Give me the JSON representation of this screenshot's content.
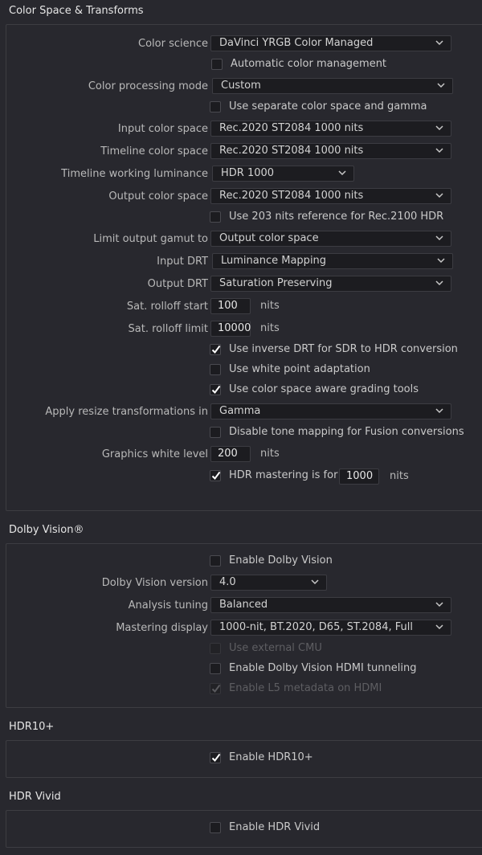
{
  "sections": {
    "color": {
      "title": "Color Space & Transforms",
      "color_science": {
        "label": "Color science",
        "value": "DaVinci YRGB Color Managed"
      },
      "auto_color": {
        "label": "Automatic color management",
        "checked": false
      },
      "processing_mode": {
        "label": "Color processing mode",
        "value": "Custom"
      },
      "separate_gamma": {
        "label": "Use separate color space and gamma",
        "checked": false
      },
      "input_cs": {
        "label": "Input color space",
        "value": "Rec.2020 ST2084 1000 nits"
      },
      "timeline_cs": {
        "label": "Timeline color space",
        "value": "Rec.2020 ST2084 1000 nits"
      },
      "timeline_lum": {
        "label": "Timeline working luminance",
        "value": "HDR 1000"
      },
      "output_cs": {
        "label": "Output color space",
        "value": "Rec.2020 ST2084 1000 nits"
      },
      "use_203": {
        "label": "Use 203 nits reference for Rec.2100 HDR",
        "checked": false
      },
      "limit_gamut": {
        "label": "Limit output gamut to",
        "value": "Output color space"
      },
      "input_drt": {
        "label": "Input DRT",
        "value": "Luminance Mapping"
      },
      "output_drt": {
        "label": "Output DRT",
        "value": "Saturation Preserving"
      },
      "sat_start": {
        "label": "Sat. rolloff start",
        "value": "100",
        "unit": "nits"
      },
      "sat_limit": {
        "label": "Sat. rolloff limit",
        "value": "10000",
        "unit": "nits"
      },
      "inverse_drt": {
        "label": "Use inverse DRT for SDR to HDR conversion",
        "checked": true
      },
      "white_point": {
        "label": "Use white point adaptation",
        "checked": false
      },
      "cs_aware": {
        "label": "Use color space aware grading tools",
        "checked": true
      },
      "resize": {
        "label": "Apply resize transformations in",
        "value": "Gamma"
      },
      "disable_tone": {
        "label": "Disable tone mapping for Fusion conversions",
        "checked": false
      },
      "gfx_white": {
        "label": "Graphics white level",
        "value": "200",
        "unit": "nits"
      },
      "hdr_mastering": {
        "label": "HDR mastering is for",
        "checked": true,
        "value": "1000",
        "unit": "nits"
      }
    },
    "dolby": {
      "title": "Dolby Vision®",
      "enable": {
        "label": "Enable Dolby Vision",
        "checked": false
      },
      "version": {
        "label": "Dolby Vision version",
        "value": "4.0"
      },
      "analysis": {
        "label": "Analysis tuning",
        "value": "Balanced"
      },
      "mastering": {
        "label": "Mastering display",
        "value": "1000-nit, BT.2020, D65, ST.2084, Full"
      },
      "external_cmu": {
        "label": "Use external CMU",
        "checked": false,
        "disabled": true
      },
      "hdmi_tunnel": {
        "label": "Enable Dolby Vision HDMI tunneling",
        "checked": false
      },
      "l5_meta": {
        "label": "Enable L5 metadata on HDMI",
        "checked": true,
        "disabled": true
      }
    },
    "hdr10": {
      "title": "HDR10+",
      "enable": {
        "label": "Enable HDR10+",
        "checked": true
      }
    },
    "vivid": {
      "title": "HDR Vivid",
      "enable": {
        "label": "Enable HDR Vivid",
        "checked": false
      }
    }
  },
  "icons": {
    "dropdown": "chevron-down-icon",
    "check": "checkmark-icon"
  },
  "colors": {
    "background": "#28282e",
    "field": "#1c1c20",
    "text": "#bdbdbd",
    "check": "#ffffff"
  }
}
